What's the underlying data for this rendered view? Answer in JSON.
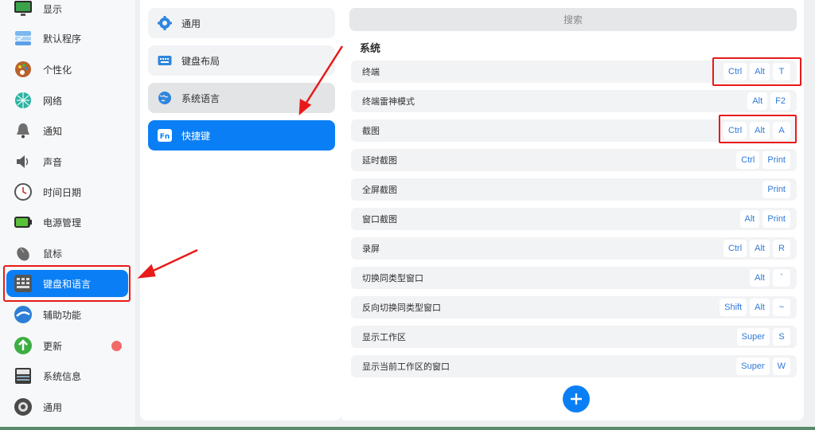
{
  "sidebar": {
    "items": [
      {
        "label": "显示",
        "icon": "monitor-icon"
      },
      {
        "label": "默认程序",
        "icon": "default-apps-icon"
      },
      {
        "label": "个性化",
        "icon": "palette-icon"
      },
      {
        "label": "网络",
        "icon": "network-icon"
      },
      {
        "label": "通知",
        "icon": "bell-icon"
      },
      {
        "label": "声音",
        "icon": "speaker-icon"
      },
      {
        "label": "时间日期",
        "icon": "clock-icon"
      },
      {
        "label": "电源管理",
        "icon": "battery-icon"
      },
      {
        "label": "鼠标",
        "icon": "mouse-icon"
      },
      {
        "label": "键盘和语言",
        "icon": "keyboard-icon"
      },
      {
        "label": "辅助功能",
        "icon": "accessibility-icon"
      },
      {
        "label": "更新",
        "icon": "update-icon"
      },
      {
        "label": "系统信息",
        "icon": "system-info-icon"
      },
      {
        "label": "通用",
        "icon": "general-icon"
      }
    ],
    "active_index": 9
  },
  "subnav": {
    "items": [
      {
        "label": "通用",
        "icon": "gear-icon"
      },
      {
        "label": "键盘布局",
        "icon": "keyboard-layout-icon"
      },
      {
        "label": "系统语言",
        "icon": "globe-icon"
      },
      {
        "label": "快捷键",
        "icon": "fn-icon",
        "icon_text": "Fn"
      }
    ],
    "active_index": 3
  },
  "search": {
    "placeholder": "搜索"
  },
  "section": {
    "title": "系统"
  },
  "shortcuts": [
    {
      "name": "终端",
      "keys": [
        "Ctrl",
        "Alt",
        "T"
      ]
    },
    {
      "name": "终端雷神模式",
      "keys": [
        "Alt",
        "F2"
      ]
    },
    {
      "name": "截图",
      "keys": [
        "Ctrl",
        "Alt",
        "A"
      ]
    },
    {
      "name": "延时截图",
      "keys": [
        "Ctrl",
        "Print"
      ]
    },
    {
      "name": "全屏截图",
      "keys": [
        "Print"
      ]
    },
    {
      "name": "窗口截图",
      "keys": [
        "Alt",
        "Print"
      ]
    },
    {
      "name": "录屏",
      "keys": [
        "Ctrl",
        "Alt",
        "R"
      ]
    },
    {
      "name": "切换同类型窗口",
      "keys": [
        "Alt",
        "`"
      ]
    },
    {
      "name": "反向切换同类型窗口",
      "keys": [
        "Shift",
        "Alt",
        "~"
      ]
    },
    {
      "name": "显示工作区",
      "keys": [
        "Super",
        "S"
      ]
    },
    {
      "name": "显示当前工作区的窗口",
      "keys": [
        "Super",
        "W"
      ]
    }
  ],
  "colors": {
    "accent": "#0a7ff5",
    "annotation": "#e81a1a",
    "key_text": "#2f79d8"
  }
}
